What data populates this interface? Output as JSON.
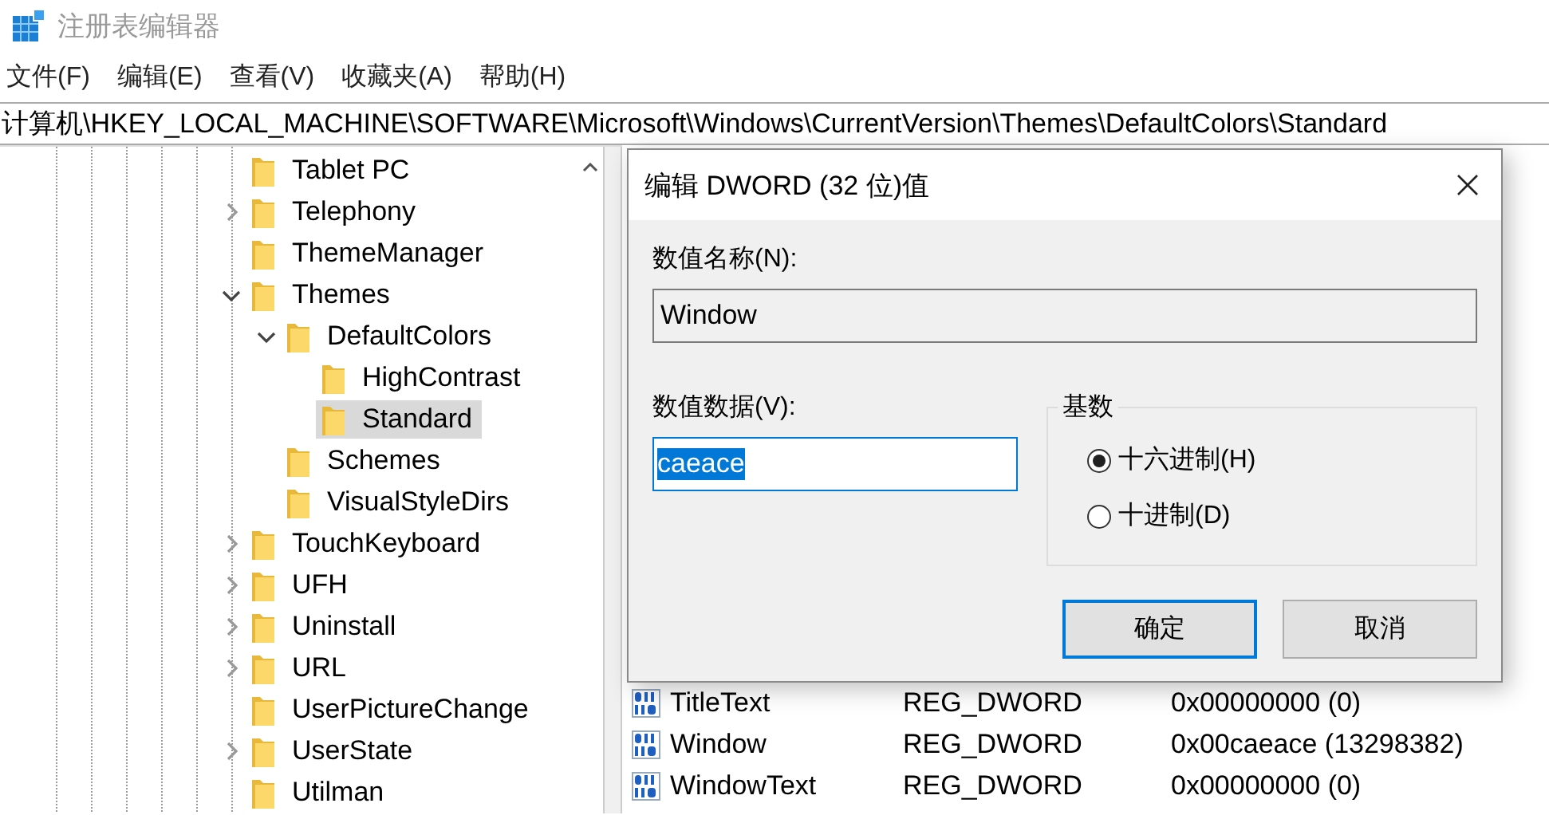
{
  "window": {
    "title": "注册表编辑器"
  },
  "menu": [
    "文件(F)",
    "编辑(E)",
    "查看(V)",
    "收藏夹(A)",
    "帮助(H)"
  ],
  "address": "计算机\\HKEY_LOCAL_MACHINE\\SOFTWARE\\Microsoft\\Windows\\CurrentVersion\\Themes\\DefaultColors\\Standard",
  "tree": [
    {
      "label": "Tablet PC",
      "selected": false
    },
    {
      "label": "Telephony",
      "selected": false,
      "expanded": false
    },
    {
      "label": "ThemeManager",
      "selected": false
    },
    {
      "label": "Themes",
      "selected": false,
      "expanded": true,
      "children": [
        {
          "label": "DefaultColors",
          "selected": false,
          "expanded": true,
          "children": [
            {
              "label": "HighContrast",
              "selected": false
            },
            {
              "label": "Standard",
              "selected": true
            }
          ]
        },
        {
          "label": "Schemes",
          "selected": false
        },
        {
          "label": "VisualStyleDirs",
          "selected": false
        }
      ]
    },
    {
      "label": "TouchKeyboard",
      "selected": false,
      "expanded": false
    },
    {
      "label": "UFH",
      "selected": false,
      "expanded": false
    },
    {
      "label": "Uninstall",
      "selected": false,
      "expanded": false
    },
    {
      "label": "URL",
      "selected": false,
      "expanded": false
    },
    {
      "label": "UserPictureChange",
      "selected": false
    },
    {
      "label": "UserState",
      "selected": false,
      "expanded": false
    },
    {
      "label": "Utilman",
      "selected": false
    }
  ],
  "values": [
    {
      "name": "TitleText",
      "type": "REG_DWORD",
      "data": "0x00000000 (0)"
    },
    {
      "name": "Window",
      "type": "REG_DWORD",
      "data": "0x00caeace (13298382)"
    },
    {
      "name": "WindowText",
      "type": "REG_DWORD",
      "data": "0x00000000 (0)"
    }
  ],
  "dialog": {
    "title": "编辑 DWORD (32 位)值",
    "name_label": "数值名称(N):",
    "name_value": "Window",
    "data_label": "数值数据(V):",
    "data_value": "caeace",
    "data_selected": true,
    "base": {
      "label": "基数",
      "options": [
        {
          "label": "十六进制(H)",
          "selected": true
        },
        {
          "label": "十进制(D)",
          "selected": false
        }
      ]
    },
    "buttons": [
      {
        "label": "确定",
        "default": true
      },
      {
        "label": "取消",
        "default": false
      }
    ]
  }
}
